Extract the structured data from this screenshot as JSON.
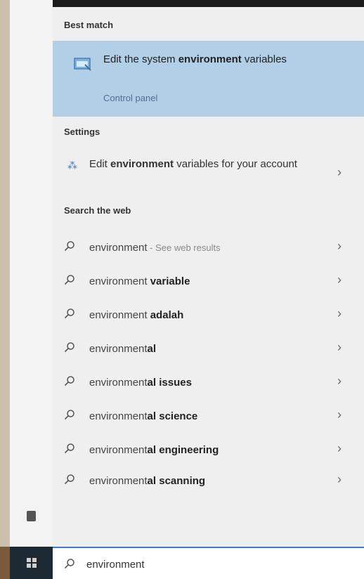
{
  "sections": {
    "best_match": "Best match",
    "settings": "Settings",
    "search_web": "Search the web"
  },
  "best_match": {
    "title_pre": "Edit the system ",
    "title_bold": "environment",
    "title_post": " variables",
    "subtitle": "Control panel",
    "icon": "control-panel-icon"
  },
  "setting": {
    "pre": "Edit ",
    "bold": "environment",
    "post": " variables for your account",
    "icon": "settings-icon"
  },
  "web_results": [
    {
      "plain": "environment",
      "bold": "",
      "hint": " - See web results"
    },
    {
      "plain": "environment ",
      "bold": "variable",
      "hint": ""
    },
    {
      "plain": "environment ",
      "bold": "adalah",
      "hint": ""
    },
    {
      "plain": "environment",
      "bold": "al",
      "hint": ""
    },
    {
      "plain": "environment",
      "bold": "al issues",
      "hint": ""
    },
    {
      "plain": "environment",
      "bold": "al science",
      "hint": ""
    },
    {
      "plain": "environment",
      "bold": "al engineering",
      "hint": ""
    },
    {
      "plain": "environment",
      "bold": "al scanning",
      "hint": ""
    }
  ],
  "chevron": "›",
  "search": {
    "value": "environment",
    "icon": "search-icon"
  },
  "colors": {
    "best_match_bg": "#b2cfe8",
    "panel_bg": "#efefef",
    "accent": "#3a7bd5"
  }
}
